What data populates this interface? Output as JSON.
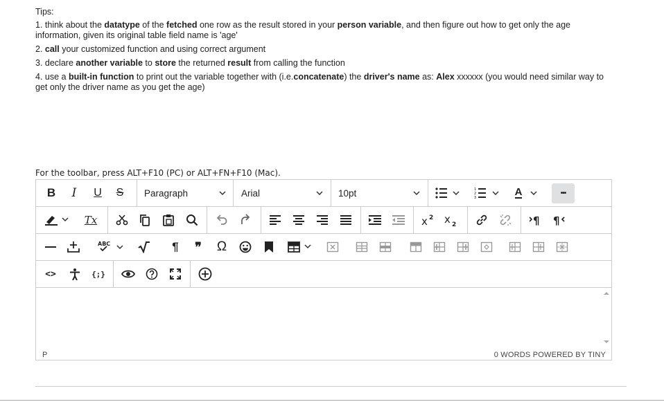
{
  "tips": {
    "title": "Tips:",
    "items": [
      [
        {
          "t": "1. think about the ",
          "b": false
        },
        {
          "t": "datatype",
          "b": true
        },
        {
          "t": " of the ",
          "b": false
        },
        {
          "t": "fetched",
          "b": true
        },
        {
          "t": " one row as the result stored in your ",
          "b": false
        },
        {
          "t": "person variable",
          "b": true
        },
        {
          "t": ", and then figure out how to get only the age information, given its original table field name is 'age'",
          "b": false
        }
      ],
      [
        {
          "t": "2. ",
          "b": false
        },
        {
          "t": "call",
          "b": true
        },
        {
          "t": " your customized function and using correct argument",
          "b": false
        }
      ],
      [
        {
          "t": "3. declare ",
          "b": false
        },
        {
          "t": "another variable",
          "b": true
        },
        {
          "t": " to ",
          "b": false
        },
        {
          "t": "store",
          "b": true
        },
        {
          "t": " the returned ",
          "b": false
        },
        {
          "t": "result",
          "b": true
        },
        {
          "t": " from calling the function",
          "b": false
        }
      ],
      [
        {
          "t": "4. use a ",
          "b": false
        },
        {
          "t": "built-in function",
          "b": true
        },
        {
          "t": " to print out the variable together with (i.e.",
          "b": false
        },
        {
          "t": "concatenate",
          "b": true
        },
        {
          "t": ") the ",
          "b": false
        },
        {
          "t": "driver's name",
          "b": true
        },
        {
          "t": " as: ",
          "b": false
        },
        {
          "t": "Alex",
          "b": true
        },
        {
          "t": " xxxxxx   (you would need similar way to get only the driver name as you get the age)",
          "b": false
        }
      ]
    ]
  },
  "toolbar_hint": "For the toolbar, press ALT+F10 (PC) or ALT+FN+F10 (Mac).",
  "toolbar": {
    "bold": "B",
    "italic": "I",
    "underline": "U",
    "strike": "S",
    "block_format": "Paragraph",
    "font_family": "Arial",
    "font_size": "10pt",
    "font_color_letter": "A",
    "more": "•••",
    "clear_format": "Tx",
    "spell_label": "ABC",
    "pilcrow": "¶",
    "quote": "❞",
    "omega": "Ω",
    "code": "<>",
    "code_block": "{;}",
    "accent_color": "#222222"
  },
  "status": {
    "path": "P",
    "words": "0 WORDS  POWERED BY TINY"
  }
}
